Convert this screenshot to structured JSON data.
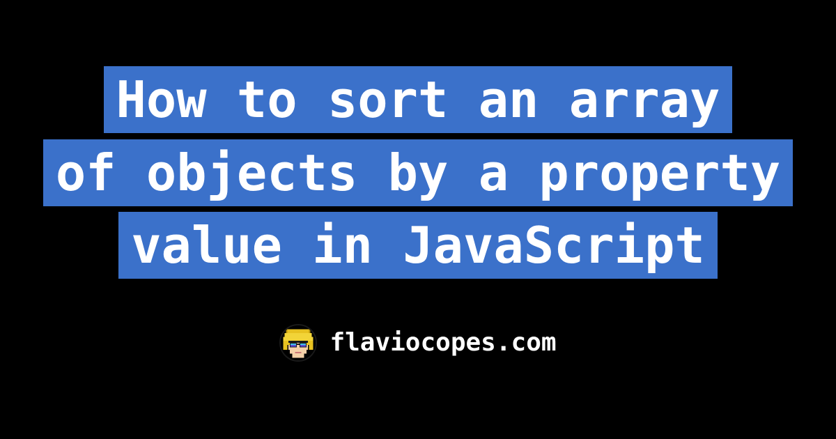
{
  "title_lines": [
    "How to sort an array",
    "of objects by a property",
    "value in JavaScript"
  ],
  "byline": {
    "site": "flaviocopes.com"
  },
  "colors": {
    "bg": "#000000",
    "highlight": "#3b71ca",
    "text": "#ffffff"
  }
}
